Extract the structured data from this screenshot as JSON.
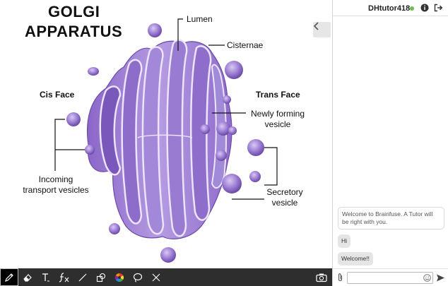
{
  "diagram": {
    "title_line1": "GOLGI",
    "title_line2": "APPARATUS",
    "cis_face": "Cis Face",
    "trans_face": "Trans Face",
    "lumen": "Lumen",
    "cisternae": "Cisternae",
    "newly_forming_line1": "Newly forming",
    "newly_forming_line2": "vesicle",
    "incoming_line1": "Incoming",
    "incoming_line2": "transport vesicles",
    "secretory_line1": "Secretory",
    "secretory_line2": "vesicle",
    "colors": {
      "stack_light": "#b79fe0",
      "stack_mid": "#9a79d2",
      "stack_dark": "#6b4aa8",
      "membrane": "#ece4fa"
    }
  },
  "toolbar": {
    "tools": [
      {
        "name": "pencil",
        "icon": "pencil-icon"
      },
      {
        "name": "eraser",
        "icon": "eraser-icon"
      },
      {
        "name": "text",
        "icon": "text-icon"
      },
      {
        "name": "formula",
        "icon": "formula-icon",
        "label": "fx"
      },
      {
        "name": "line",
        "icon": "line-icon"
      },
      {
        "name": "shapes",
        "icon": "shapes-icon"
      },
      {
        "name": "color",
        "icon": "color-wheel-icon"
      },
      {
        "name": "lasso",
        "icon": "lasso-icon"
      },
      {
        "name": "clear",
        "icon": "close-icon"
      },
      {
        "name": "snapshot",
        "icon": "camera-icon"
      }
    ],
    "active_tool": "pencil"
  },
  "chat": {
    "tutor_name": "DHtutor418",
    "status_color": "#6cc04a",
    "messages": [
      {
        "text": "Welcome to Brainfuse. A Tutor will be right with you."
      },
      {
        "text": "Hi"
      },
      {
        "text": "Welcome!!"
      }
    ],
    "input": {
      "value": "",
      "placeholder": ""
    }
  }
}
